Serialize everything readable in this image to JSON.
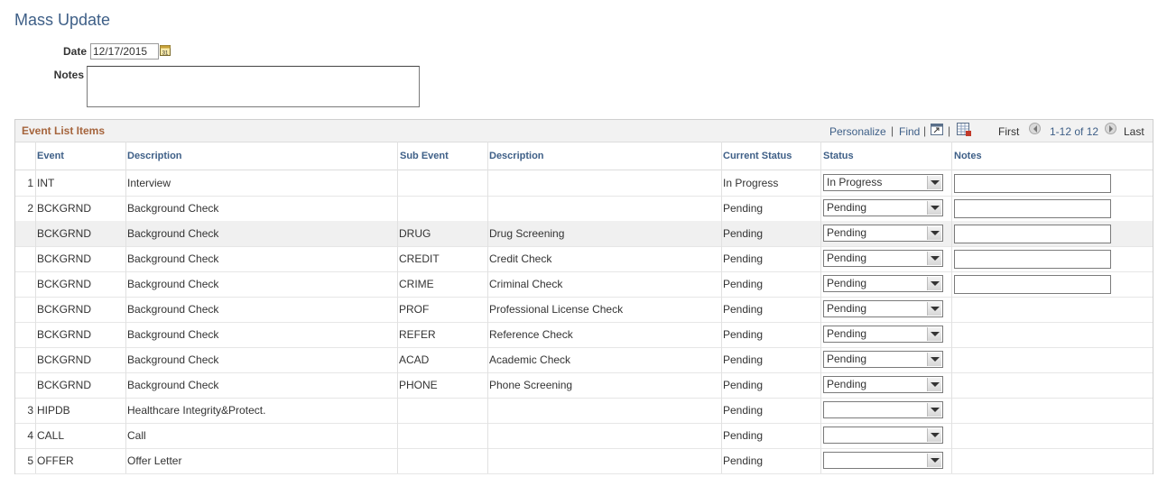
{
  "page": {
    "title": "Mass Update"
  },
  "form": {
    "date_label": "Date",
    "date_value": "12/17/2015",
    "notes_label": "Notes",
    "notes_value": ""
  },
  "grid": {
    "title": "Event List Items",
    "personalize": "Personalize",
    "find": "Find",
    "first": "First",
    "range": "1-12 of 12",
    "last": "Last",
    "columns": {
      "event": "Event",
      "description": "Description",
      "sub_event": "Sub Event",
      "sub_description": "Description",
      "current_status": "Current Status",
      "status": "Status",
      "notes": "Notes"
    },
    "rows": [
      {
        "num": "1",
        "event": "INT",
        "description": "Interview",
        "sub_event": "",
        "sub_description": "",
        "current_status": "In Progress",
        "status": "In Progress",
        "notes_field": true
      },
      {
        "num": "2",
        "event": "BCKGRND",
        "description": "Background Check",
        "sub_event": "",
        "sub_description": "",
        "current_status": "Pending",
        "status": "Pending",
        "notes_field": true
      },
      {
        "num": "",
        "event": "BCKGRND",
        "description": "Background Check",
        "sub_event": "DRUG",
        "sub_description": "Drug Screening",
        "current_status": "Pending",
        "status": "Pending",
        "notes_field": true
      },
      {
        "num": "",
        "event": "BCKGRND",
        "description": "Background Check",
        "sub_event": "CREDIT",
        "sub_description": "Credit Check",
        "current_status": "Pending",
        "status": "Pending",
        "notes_field": true
      },
      {
        "num": "",
        "event": "BCKGRND",
        "description": "Background Check",
        "sub_event": "CRIME",
        "sub_description": "Criminal Check",
        "current_status": "Pending",
        "status": "Pending",
        "notes_field": true
      },
      {
        "num": "",
        "event": "BCKGRND",
        "description": "Background Check",
        "sub_event": "PROF",
        "sub_description": "Professional License Check",
        "current_status": "Pending",
        "status": "Pending",
        "notes_field": false
      },
      {
        "num": "",
        "event": "BCKGRND",
        "description": "Background Check",
        "sub_event": "REFER",
        "sub_description": "Reference Check",
        "current_status": "Pending",
        "status": "Pending",
        "notes_field": false
      },
      {
        "num": "",
        "event": "BCKGRND",
        "description": "Background Check",
        "sub_event": "ACAD",
        "sub_description": "Academic Check",
        "current_status": "Pending",
        "status": "Pending",
        "notes_field": false
      },
      {
        "num": "",
        "event": "BCKGRND",
        "description": "Background Check",
        "sub_event": "PHONE",
        "sub_description": "Phone Screening",
        "current_status": "Pending",
        "status": "Pending",
        "notes_field": false
      },
      {
        "num": "3",
        "event": "HIPDB",
        "description": "Healthcare Integrity&Protect.",
        "sub_event": "",
        "sub_description": "",
        "current_status": "Pending",
        "status": "",
        "notes_field": false
      },
      {
        "num": "4",
        "event": "CALL",
        "description": "Call",
        "sub_event": "",
        "sub_description": "",
        "current_status": "Pending",
        "status": "",
        "notes_field": false
      },
      {
        "num": "5",
        "event": "OFFER",
        "description": "Offer Letter",
        "sub_event": "",
        "sub_description": "",
        "current_status": "Pending",
        "status": "",
        "notes_field": false
      }
    ],
    "highlighted_row": 2
  },
  "icons": [
    "calendar-icon",
    "zoom-icon",
    "download-icon",
    "first-arrow-icon",
    "last-arrow-icon",
    "dropdown-arrow-icon"
  ],
  "colors": {
    "title": "#3e5f87",
    "grid_title": "#a5643c",
    "link": "#3e5f87",
    "header_bg": "#f2f2f2"
  }
}
